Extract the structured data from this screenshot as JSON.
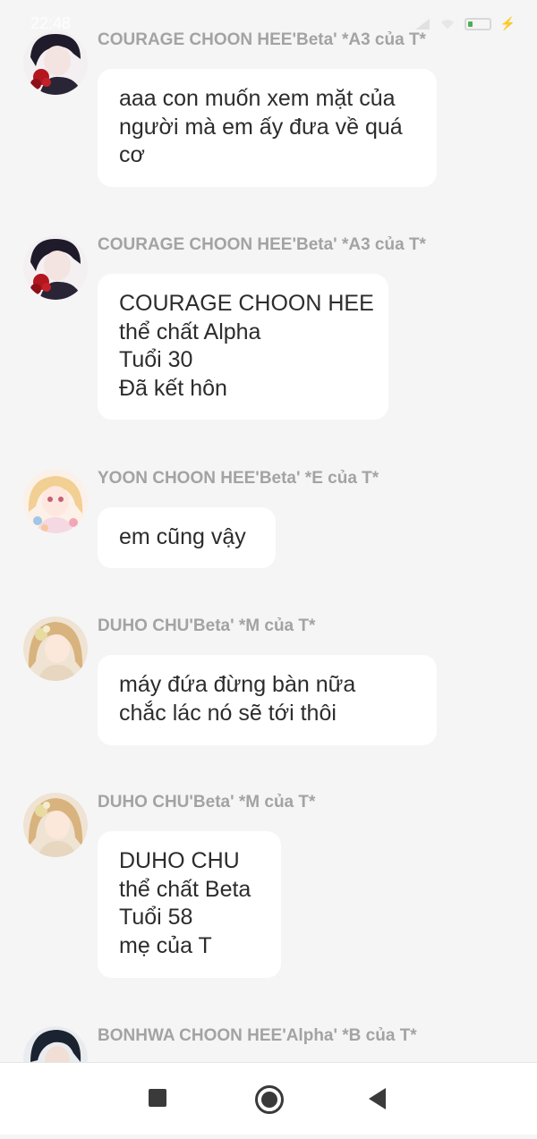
{
  "status_bar": {
    "time": "22:48"
  },
  "messages": [
    {
      "sender": "COURAGE CHOON HEE'Beta' *A3 của T*",
      "avatar": "dark-haired-boy-with-rose-avatar",
      "lines": [
        "aaa con muốn xem mặt của",
        "người mà em ấy đưa về quá",
        "cơ"
      ]
    },
    {
      "sender": "COURAGE CHOON HEE'Beta' *A3 của T*",
      "avatar": "dark-haired-boy-with-rose-avatar",
      "lines": [
        "COURAGE CHOON HEE",
        "thể chất Alpha",
        "Tuổi 30",
        "Đã kết hôn"
      ]
    },
    {
      "sender": "YOON CHOON HEE'Beta' *E của T*",
      "avatar": "blonde-girl-with-flowers-avatar",
      "lines": [
        "em cũng vậy"
      ]
    },
    {
      "sender": "DUHO CHU'Beta' *M của T*",
      "avatar": "light-haired-woman-with-flowers-avatar",
      "lines": [
        "máy đứa đừng bàn nữa",
        "chắc lác nó sẽ tới thôi"
      ]
    },
    {
      "sender": "DUHO CHU'Beta' *M của T*",
      "avatar": "light-haired-woman-with-flowers-avatar",
      "lines": [
        "DUHO CHU",
        "thể chất Beta",
        "Tuổi 58",
        "mẹ của T"
      ]
    },
    {
      "sender": "BONHWA CHOON HEE'Alpha' *B của T*",
      "avatar": "dark-haired-man-avatar",
      "lines": []
    }
  ],
  "nav_bar": {
    "recents": "square-recents-icon",
    "home": "circle-home-icon",
    "back": "triangle-back-icon"
  },
  "colors": {
    "background": "#f5f5f5",
    "bubble": "#ffffff",
    "sender_text": "#a3a3a3",
    "message_text": "#2c2c2c"
  }
}
